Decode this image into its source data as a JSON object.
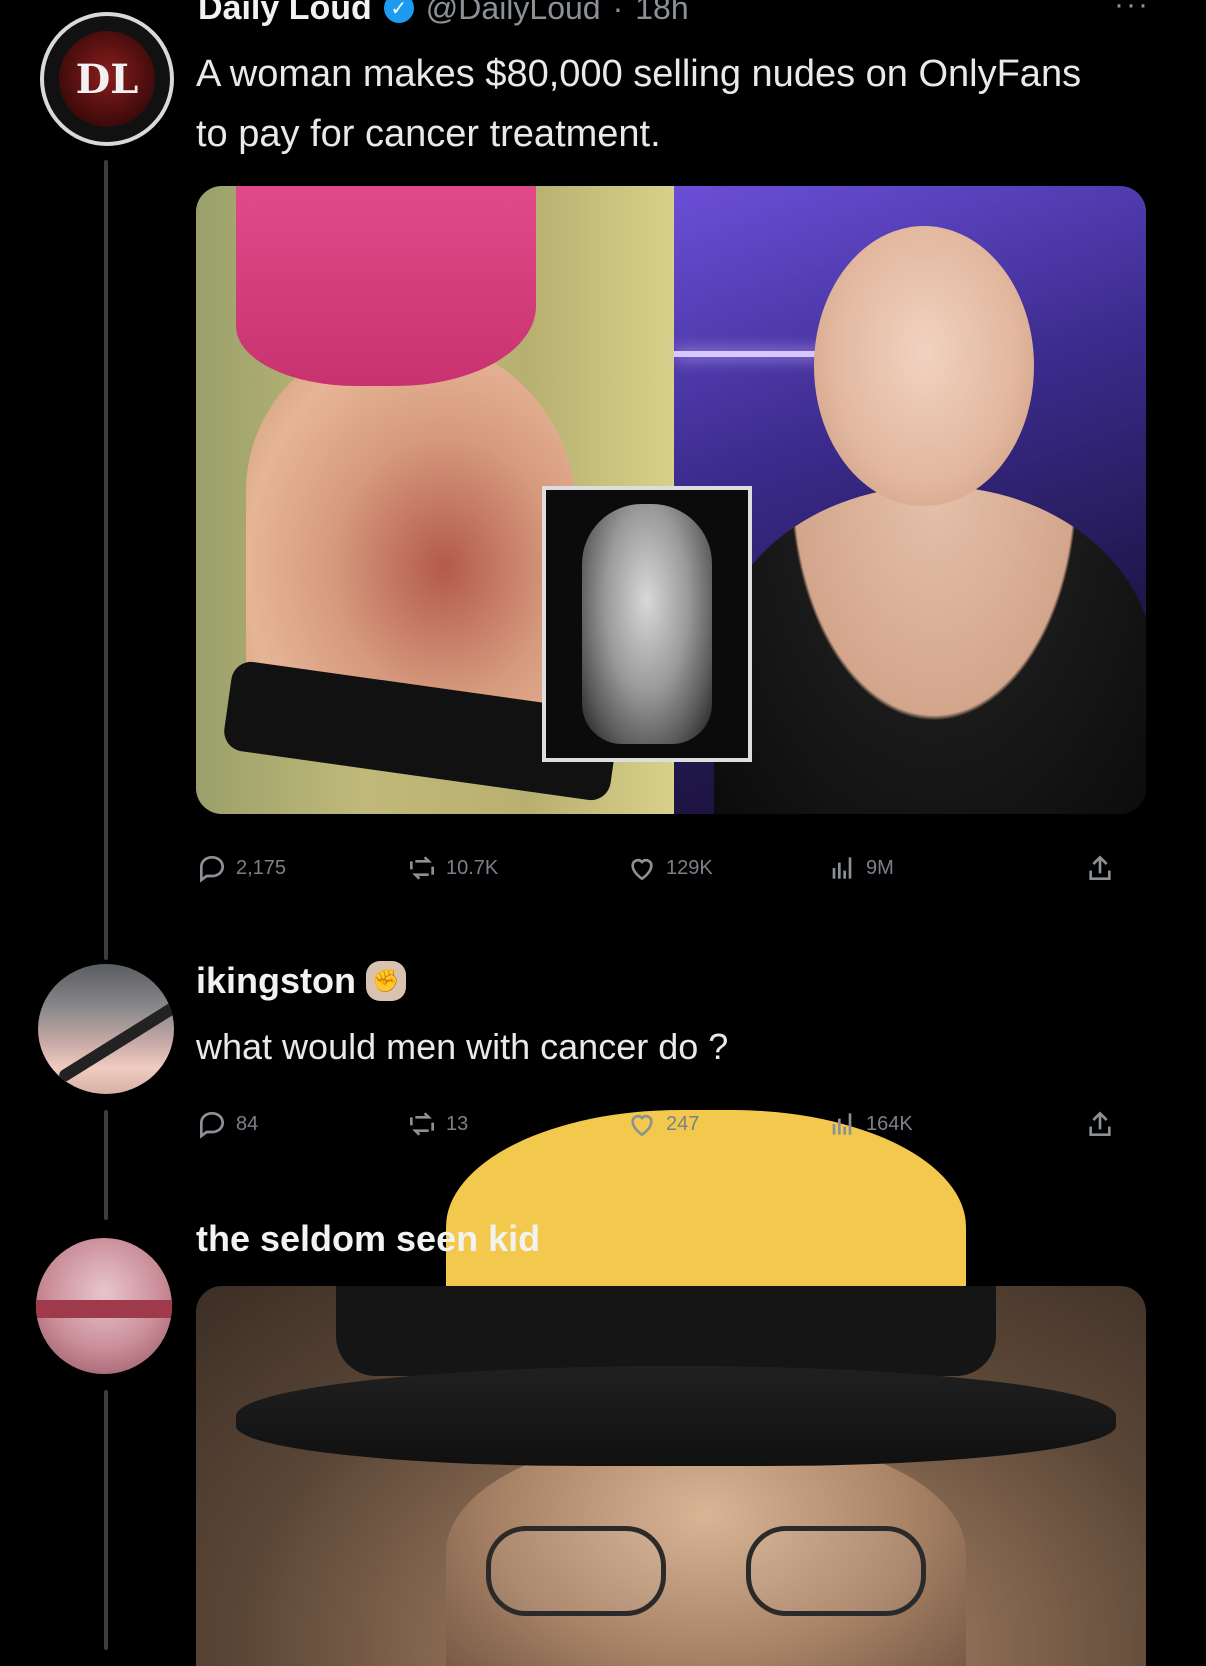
{
  "tweet": {
    "author_name": "Daily Loud",
    "author_handle": "@DailyLoud",
    "time": "18h",
    "separator": "·",
    "text": "A woman makes $80,000 selling nudes on OnlyFans to pay for cancer treatment.",
    "avatar_letters": "DL",
    "more_label": "···",
    "stats": {
      "replies": "2,175",
      "reposts": "10.7K",
      "likes": "129K",
      "views": "9M"
    }
  },
  "reply1": {
    "author_name": "ikingston",
    "text": "what would men with cancer do ?",
    "stats": {
      "replies": "84",
      "reposts": "13",
      "likes": "247",
      "views": "164K"
    }
  },
  "reply2": {
    "author_name": "the seldom seen kid"
  },
  "colors": {
    "background": "#000000",
    "text": "#e7e9ea",
    "muted": "#8b9197",
    "verified": "#1d9bf0",
    "thread_line": "#3a3d41"
  },
  "icons": [
    "reply-icon",
    "repost-icon",
    "like-icon",
    "views-icon",
    "share-icon",
    "verified-badge-icon",
    "more-icon",
    "flexed-fist-emoji",
    "astonished-face-emoji",
    "crying-laughing-emoji"
  ]
}
